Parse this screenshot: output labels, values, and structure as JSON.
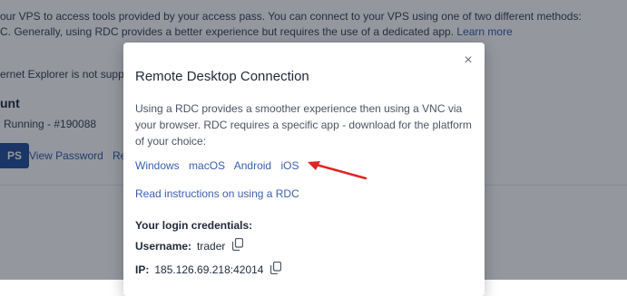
{
  "background": {
    "line1": "our VPS to access tools provided by your access pass. You can connect to your VPS using one of two different methods:",
    "line2": "C. Generally, using RDC provides a better experience but requires the use of a dedicated app.",
    "learn_more": "Learn more",
    "ie_note": "ernet Explorer is not suppor",
    "section_title": "unt",
    "status": "Running - #190088",
    "vps_button": "PS",
    "view_password": "View Password",
    "partial_link": "Re"
  },
  "modal": {
    "title": "Remote Desktop Connection",
    "description": "Using a RDC provides a smoother experience then using a VNC via your browser. RDC requires a specific app - download for the platform of your choice:",
    "platforms": [
      "Windows",
      "macOS",
      "Android",
      "iOS"
    ],
    "instructions_link": "Read instructions on using a RDC",
    "credentials": {
      "heading": "Your login credentials:",
      "username_label": "Username:",
      "username_value": "trader",
      "ip_label": "IP:",
      "ip_value": "185.126.69.218:42014"
    },
    "close_symbol": "×"
  },
  "colors": {
    "accent": "#3b5fb0",
    "arrow": "#e02424",
    "button": "#1f4f9c"
  }
}
